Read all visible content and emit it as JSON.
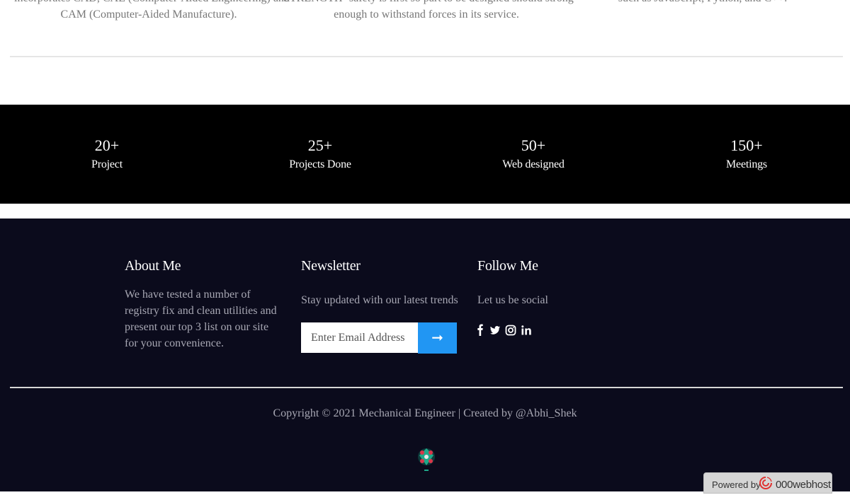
{
  "features": [
    {
      "line1": "incorporates CAD, CAE (Computer-Aided Engineering) and",
      "line2": "CAM (Computer-Aided Manufacture)."
    },
    {
      "line1": "STRENGTH- safety is first so part to be designed should strong",
      "line2": "enough to withstand forces in its service."
    },
    {
      "line1": "such as JavaScript, Python, and C++.",
      "line2": ""
    }
  ],
  "stats": [
    {
      "number": "20+",
      "label": "Project"
    },
    {
      "number": "25+",
      "label": "Projects Done"
    },
    {
      "number": "50+",
      "label": "Web designed"
    },
    {
      "number": "150+",
      "label": "Meetings"
    }
  ],
  "footer": {
    "about": {
      "title": "About Me",
      "text": "We have tested a number of registry fix and clean utilities and present our top 3 list on our site for your convenience."
    },
    "newsletter": {
      "title": "Newsletter",
      "text": "Stay updated with our latest trends",
      "email_placeholder": "Enter Email Address",
      "submit_icon": "arrow-right-icon"
    },
    "follow": {
      "title": "Follow Me",
      "text": "Let us be social",
      "icons": [
        "facebook-icon",
        "twitter-icon",
        "instagram-icon",
        "linkedin-icon"
      ]
    },
    "copyright": "Copyright © 2021 Mechanical Engineer | Created by @Abhi_Shek"
  },
  "powered_by": {
    "label": "Powered by",
    "brand": "000webhost"
  },
  "colors": {
    "stats_bg": "#000000",
    "footer_bg": "#0b0b1c",
    "accent": "#2196f3",
    "muted_text": "#a7a7b3"
  }
}
